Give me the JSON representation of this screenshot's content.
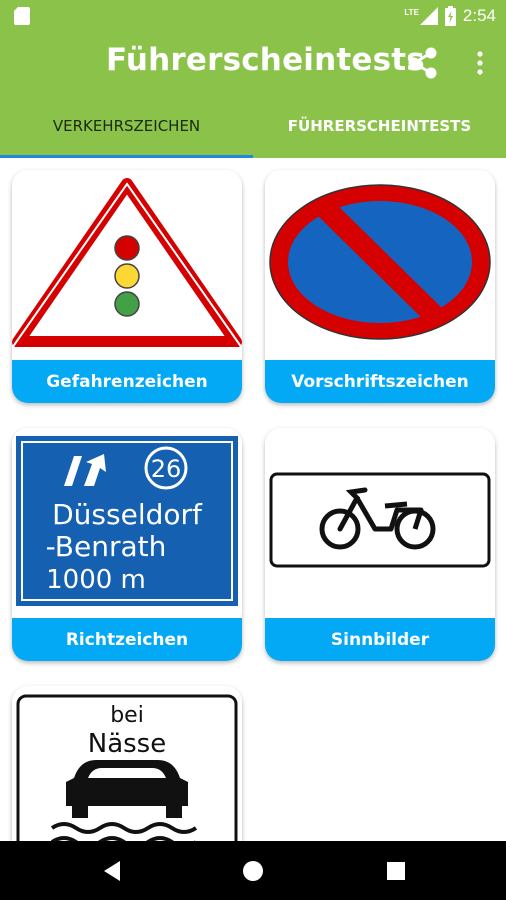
{
  "status_bar": {
    "network": "LTE",
    "time": "2:54",
    "icons": [
      "sd-card-icon",
      "lte-signal-icon",
      "battery-charging-icon"
    ]
  },
  "app_bar": {
    "title": "Führerscheintests",
    "actions": [
      "share-icon",
      "more-vert-icon"
    ]
  },
  "tabs": [
    {
      "label": "VERKEHRSZEICHEN",
      "selected": true
    },
    {
      "label": "FÜHRERSCHEINTESTS",
      "selected": false
    }
  ],
  "categories": [
    {
      "label": "Gefahrenzeichen",
      "icon": "traffic-light-warning-sign"
    },
    {
      "label": "Vorschriftszeichen",
      "icon": "no-parking-sign"
    },
    {
      "label": "Richtzeichen",
      "icon": "motorway-exit-sign",
      "sign_text": {
        "exit_number": "26",
        "line1": "Düsseldorf",
        "line2": "-Benrath",
        "line3": "1000 m"
      }
    },
    {
      "label": "Sinnbilder",
      "icon": "moped-sign"
    },
    {
      "label": "",
      "icon": "wet-road-sign",
      "sign_text": {
        "line1": "bei",
        "line2": "Nässe"
      }
    }
  ],
  "colors": {
    "app_bar": "#8bc34a",
    "tab_indicator": "#1e88e5",
    "card_label": "#03a9f4",
    "sign_red": "#d50000",
    "sign_blue": "#1565c0",
    "nav_bar": "#000000"
  },
  "nav_bar": [
    "back-icon",
    "home-icon",
    "recents-icon"
  ]
}
